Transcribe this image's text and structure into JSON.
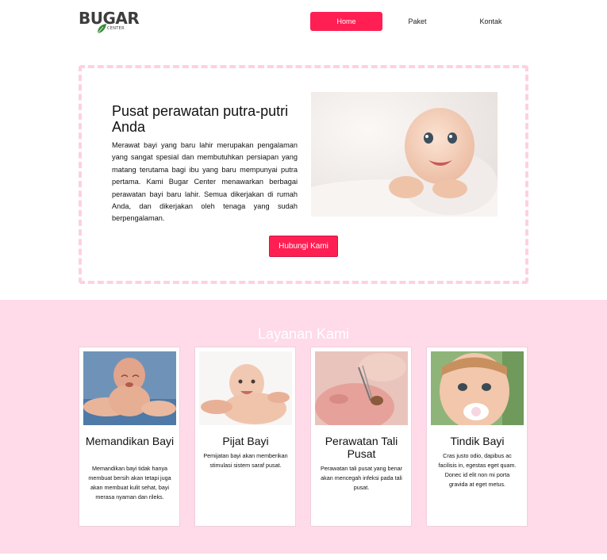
{
  "header": {
    "logo_text": "BUGAR",
    "logo_sub": "CENTER",
    "nav": [
      {
        "label": "Home"
      },
      {
        "label": "Paket"
      },
      {
        "label": "Kontak"
      }
    ]
  },
  "hero": {
    "title": "Pusat perawatan putra-putri Anda",
    "text": "Merawat bayi yang baru lahir merupakan pengalaman yang sangat spesial dan membutuhkan persiapan yang matang terutama bagi ibu yang baru mempunyai putra pertama. Kami Bugar Center menawarkan berbagai perawatan bayi baru lahir. Semua dikerjakan di rumah Anda, dan dikerjakan oleh tenaga yang sudah berpengalaman.",
    "button_label": "Hubungi Kami"
  },
  "services": {
    "title": "Layanan Kami",
    "cards": [
      {
        "title": "Memandikan Bayi",
        "desc": "Memandikan bayi tidak hanya membuat bersih akan tetapi juga akan membuat kulit sehat, bayi merasa nyaman dan rileks."
      },
      {
        "title": "Pijat Bayi",
        "desc": "Pemijatan bayi akan memberikan stimulasi sistem saraf pusat."
      },
      {
        "title": "Perawatan Tali Pusat",
        "desc": "Perawatan tali pusat yang benar akan mencegah infeksi pada tali pusat."
      },
      {
        "title": "Tindik Bayi",
        "desc": "Cras justo odio, dapibus ac facilisis in, egestas eget quam. Donec id elit non mi porta gravida at eget metus."
      }
    ]
  },
  "colors": {
    "accent": "#ff1f53",
    "services_bg": "#ffdae8",
    "hero_border": "#ffd1df"
  }
}
